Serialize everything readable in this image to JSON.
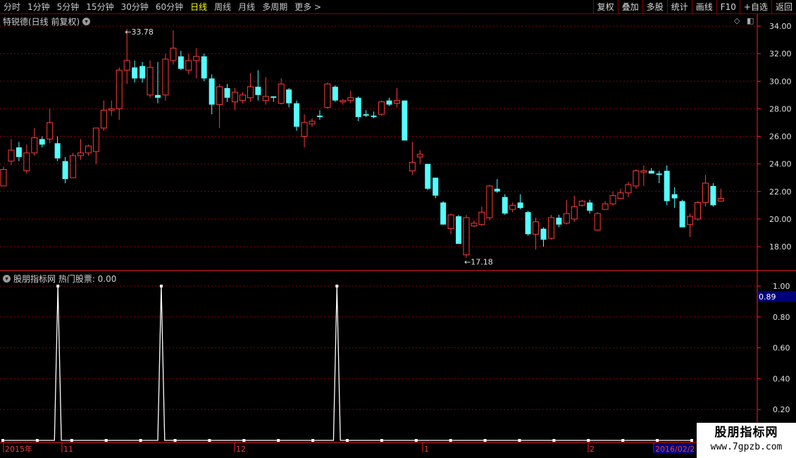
{
  "toolbar": {
    "tabs": [
      {
        "label": "分时",
        "active": false
      },
      {
        "label": "1分钟",
        "active": false
      },
      {
        "label": "5分钟",
        "active": false
      },
      {
        "label": "15分钟",
        "active": false
      },
      {
        "label": "30分钟",
        "active": false
      },
      {
        "label": "60分钟",
        "active": false
      },
      {
        "label": "日线",
        "active": true
      },
      {
        "label": "周线",
        "active": false
      },
      {
        "label": "月线",
        "active": false
      },
      {
        "label": "多周期",
        "active": false
      },
      {
        "label": "更多 >",
        "active": false
      }
    ],
    "buttons": [
      "复权",
      "叠加",
      "多股",
      "统计",
      "画线",
      "F10",
      "+自选",
      "返回"
    ]
  },
  "main_chart": {
    "title": "特锐德(日线 前复权)",
    "corner_icons": [
      "◇",
      "◧"
    ],
    "high_label": "33.78",
    "low_label": "17.18"
  },
  "indicator": {
    "title": "股朋指标网 热门股票: 0.00",
    "cursor_value": "0.89"
  },
  "date_axis": [
    "2015年",
    "11",
    "12",
    "1",
    "2",
    "2016/02/2"
  ],
  "watermark": {
    "line1": "股朋指标网",
    "line2": "www.7gpzb.com"
  },
  "colors": {
    "up": "#ff3b3b",
    "down": "#54ffff",
    "grid": "#8b0000",
    "axis": "#ff2020",
    "indicator": "#ffffff"
  },
  "chart_data": [
    {
      "type": "candlestick",
      "title": "特锐德(日线 前复权)",
      "ylim": [
        17,
        35
      ],
      "yticks": [
        18,
        20,
        22,
        24,
        26,
        28,
        30,
        32,
        34
      ],
      "candles": [
        {
          "o": 22.4,
          "h": 23.8,
          "l": 22.4,
          "c": 23.6
        },
        {
          "o": 24.2,
          "h": 25.8,
          "l": 23.9,
          "c": 25.0
        },
        {
          "o": 25.2,
          "h": 25.6,
          "l": 24.2,
          "c": 24.5
        },
        {
          "o": 23.5,
          "h": 25.4,
          "l": 23.3,
          "c": 24.8
        },
        {
          "o": 24.8,
          "h": 26.6,
          "l": 24.6,
          "c": 25.9
        },
        {
          "o": 25.8,
          "h": 26.0,
          "l": 25.2,
          "c": 25.4
        },
        {
          "o": 25.8,
          "h": 28.0,
          "l": 25.5,
          "c": 27.0
        },
        {
          "o": 25.5,
          "h": 26.0,
          "l": 24.2,
          "c": 24.4
        },
        {
          "o": 24.2,
          "h": 24.5,
          "l": 22.6,
          "c": 22.9
        },
        {
          "o": 23.0,
          "h": 24.8,
          "l": 23.0,
          "c": 24.6
        },
        {
          "o": 24.6,
          "h": 25.8,
          "l": 24.3,
          "c": 24.8
        },
        {
          "o": 24.8,
          "h": 25.4,
          "l": 24.6,
          "c": 25.3
        },
        {
          "o": 24.9,
          "h": 26.6,
          "l": 24.0,
          "c": 26.6
        },
        {
          "o": 26.6,
          "h": 28.6,
          "l": 26.4,
          "c": 27.9
        },
        {
          "o": 27.9,
          "h": 28.6,
          "l": 27.5,
          "c": 28.0
        },
        {
          "o": 28.0,
          "h": 31.0,
          "l": 27.2,
          "c": 30.8
        },
        {
          "o": 30.8,
          "h": 33.8,
          "l": 29.8,
          "c": 31.5
        },
        {
          "o": 31.0,
          "h": 31.5,
          "l": 29.9,
          "c": 30.2
        },
        {
          "o": 31.1,
          "h": 31.4,
          "l": 29.9,
          "c": 30.2
        },
        {
          "o": 29.0,
          "h": 31.5,
          "l": 28.8,
          "c": 31.0
        },
        {
          "o": 29.0,
          "h": 31.4,
          "l": 28.4,
          "c": 28.8
        },
        {
          "o": 29.0,
          "h": 32.0,
          "l": 28.6,
          "c": 31.6
        },
        {
          "o": 31.5,
          "h": 33.7,
          "l": 31.2,
          "c": 32.4
        },
        {
          "o": 31.8,
          "h": 32.2,
          "l": 30.8,
          "c": 30.9
        },
        {
          "o": 30.8,
          "h": 32.0,
          "l": 30.5,
          "c": 31.5
        },
        {
          "o": 31.5,
          "h": 32.4,
          "l": 30.2,
          "c": 31.8
        },
        {
          "o": 31.8,
          "h": 32.0,
          "l": 30.0,
          "c": 30.2
        },
        {
          "o": 30.2,
          "h": 30.5,
          "l": 27.6,
          "c": 28.3
        },
        {
          "o": 28.3,
          "h": 29.8,
          "l": 26.6,
          "c": 29.6
        },
        {
          "o": 29.5,
          "h": 29.8,
          "l": 28.5,
          "c": 28.8
        },
        {
          "o": 28.5,
          "h": 29.5,
          "l": 27.9,
          "c": 29.2
        },
        {
          "o": 28.6,
          "h": 29.2,
          "l": 28.4,
          "c": 29.0
        },
        {
          "o": 28.8,
          "h": 30.6,
          "l": 28.5,
          "c": 29.6
        },
        {
          "o": 29.6,
          "h": 30.8,
          "l": 28.6,
          "c": 29.0
        },
        {
          "o": 28.6,
          "h": 30.3,
          "l": 28.3,
          "c": 28.9
        },
        {
          "o": 28.9,
          "h": 28.9,
          "l": 28.5,
          "c": 28.8
        },
        {
          "o": 28.4,
          "h": 30.2,
          "l": 28.3,
          "c": 29.8
        },
        {
          "o": 29.4,
          "h": 29.5,
          "l": 28.1,
          "c": 28.4
        },
        {
          "o": 28.4,
          "h": 28.6,
          "l": 26.4,
          "c": 26.7
        },
        {
          "o": 26.0,
          "h": 27.6,
          "l": 25.2,
          "c": 27.0
        },
        {
          "o": 26.9,
          "h": 27.3,
          "l": 26.7,
          "c": 27.1
        },
        {
          "o": 27.5,
          "h": 27.9,
          "l": 27.2,
          "c": 27.4
        },
        {
          "o": 28.1,
          "h": 29.9,
          "l": 28.0,
          "c": 29.8
        },
        {
          "o": 29.6,
          "h": 29.7,
          "l": 28.5,
          "c": 28.6
        },
        {
          "o": 28.5,
          "h": 28.7,
          "l": 28.3,
          "c": 28.6
        },
        {
          "o": 28.6,
          "h": 29.3,
          "l": 28.4,
          "c": 28.8
        },
        {
          "o": 28.8,
          "h": 28.9,
          "l": 27.1,
          "c": 27.4
        },
        {
          "o": 27.6,
          "h": 27.9,
          "l": 27.4,
          "c": 27.5
        },
        {
          "o": 27.5,
          "h": 27.8,
          "l": 27.3,
          "c": 27.4
        },
        {
          "o": 27.6,
          "h": 28.6,
          "l": 27.5,
          "c": 28.5
        },
        {
          "o": 28.6,
          "h": 28.8,
          "l": 28.2,
          "c": 28.3
        },
        {
          "o": 28.4,
          "h": 29.5,
          "l": 28.1,
          "c": 28.6
        },
        {
          "o": 28.6,
          "h": 28.6,
          "l": 25.7,
          "c": 25.7
        },
        {
          "o": 23.5,
          "h": 25.6,
          "l": 23.2,
          "c": 24.1
        },
        {
          "o": 24.5,
          "h": 25.0,
          "l": 24.0,
          "c": 24.7
        },
        {
          "o": 24.0,
          "h": 24.0,
          "l": 22.1,
          "c": 22.2
        },
        {
          "o": 23.0,
          "h": 23.0,
          "l": 21.5,
          "c": 21.7
        },
        {
          "o": 21.2,
          "h": 21.3,
          "l": 19.6,
          "c": 19.6
        },
        {
          "o": 19.3,
          "h": 20.4,
          "l": 18.9,
          "c": 20.3
        },
        {
          "o": 20.2,
          "h": 20.3,
          "l": 18.2,
          "c": 18.2
        },
        {
          "o": 17.4,
          "h": 20.3,
          "l": 17.2,
          "c": 20.1
        },
        {
          "o": 19.5,
          "h": 19.9,
          "l": 19.4,
          "c": 19.7
        },
        {
          "o": 19.6,
          "h": 20.9,
          "l": 19.5,
          "c": 20.5
        },
        {
          "o": 20.1,
          "h": 22.5,
          "l": 19.9,
          "c": 22.4
        },
        {
          "o": 22.2,
          "h": 22.9,
          "l": 21.9,
          "c": 22.0
        },
        {
          "o": 21.6,
          "h": 21.8,
          "l": 20.3,
          "c": 20.4
        },
        {
          "o": 20.7,
          "h": 21.2,
          "l": 20.5,
          "c": 21.0
        },
        {
          "o": 21.2,
          "h": 21.8,
          "l": 20.7,
          "c": 20.8
        },
        {
          "o": 20.5,
          "h": 20.6,
          "l": 18.8,
          "c": 18.9
        },
        {
          "o": 18.9,
          "h": 20.1,
          "l": 17.8,
          "c": 19.8
        },
        {
          "o": 19.3,
          "h": 19.4,
          "l": 18.0,
          "c": 18.5
        },
        {
          "o": 18.6,
          "h": 20.3,
          "l": 18.5,
          "c": 20.1
        },
        {
          "o": 20.1,
          "h": 20.3,
          "l": 19.4,
          "c": 19.6
        },
        {
          "o": 19.7,
          "h": 21.4,
          "l": 19.6,
          "c": 20.4
        },
        {
          "o": 20.0,
          "h": 21.7,
          "l": 19.8,
          "c": 20.9
        },
        {
          "o": 21.0,
          "h": 21.4,
          "l": 20.9,
          "c": 21.3
        },
        {
          "o": 21.2,
          "h": 21.4,
          "l": 20.4,
          "c": 20.6
        },
        {
          "o": 19.2,
          "h": 20.5,
          "l": 19.2,
          "c": 20.4
        },
        {
          "o": 20.7,
          "h": 21.3,
          "l": 20.7,
          "c": 21.1
        },
        {
          "o": 21.1,
          "h": 22.0,
          "l": 21.0,
          "c": 21.7
        },
        {
          "o": 21.5,
          "h": 22.2,
          "l": 21.5,
          "c": 21.9
        },
        {
          "o": 21.9,
          "h": 22.7,
          "l": 21.6,
          "c": 22.5
        },
        {
          "o": 22.4,
          "h": 23.6,
          "l": 22.2,
          "c": 23.5
        },
        {
          "o": 23.4,
          "h": 23.9,
          "l": 22.4,
          "c": 23.5
        },
        {
          "o": 23.5,
          "h": 23.7,
          "l": 23.3,
          "c": 23.3
        },
        {
          "o": 23.3,
          "h": 23.5,
          "l": 22.6,
          "c": 23.2
        },
        {
          "o": 23.5,
          "h": 23.9,
          "l": 21.0,
          "c": 21.3
        },
        {
          "o": 21.8,
          "h": 22.3,
          "l": 20.8,
          "c": 21.5
        },
        {
          "o": 21.3,
          "h": 21.4,
          "l": 19.4,
          "c": 19.4
        },
        {
          "o": 19.6,
          "h": 20.4,
          "l": 18.7,
          "c": 20.2
        },
        {
          "o": 20.0,
          "h": 21.3,
          "l": 19.9,
          "c": 21.2
        },
        {
          "o": 21.2,
          "h": 23.2,
          "l": 20.9,
          "c": 22.6
        },
        {
          "o": 22.4,
          "h": 22.6,
          "l": 20.9,
          "c": 21.0
        },
        {
          "o": 21.3,
          "h": 22.2,
          "l": 21.3,
          "c": 21.5
        }
      ]
    },
    {
      "type": "line",
      "title": "股朋指标网 热门股票",
      "ylim": [
        0,
        1.05
      ],
      "yticks": [
        0.2,
        0.4,
        0.6,
        0.8,
        1.0
      ],
      "values": [
        0,
        0,
        0,
        0,
        0,
        0,
        0,
        0,
        0,
        0,
        0,
        0,
        0,
        0,
        0,
        0,
        1,
        0,
        0,
        0,
        0,
        0,
        0,
        0,
        0,
        0,
        0,
        0,
        0,
        0,
        0,
        0,
        0,
        0,
        0,
        0,
        0,
        0,
        0,
        0,
        0,
        0,
        0,
        0,
        0,
        0,
        1,
        0,
        0,
        0,
        0,
        0,
        0,
        0,
        0,
        0,
        0,
        0,
        0,
        0,
        0,
        0,
        0,
        0,
        0,
        0,
        0,
        0,
        0,
        0,
        0,
        0,
        0,
        0,
        0,
        0,
        0,
        0,
        0,
        0,
        0,
        0,
        0,
        0,
        0,
        0,
        0,
        0,
        0,
        0,
        0,
        0,
        0,
        0,
        0,
        0,
        0,
        1,
        0,
        0,
        0,
        0,
        0,
        0,
        0,
        0,
        0,
        0,
        0,
        0,
        0,
        0,
        0,
        0,
        0,
        0,
        0,
        0,
        0,
        0,
        0,
        0,
        0,
        0,
        0,
        0,
        0,
        0,
        0,
        0,
        0,
        0,
        0,
        0,
        0,
        0,
        0,
        0,
        0,
        0,
        0,
        0,
        0,
        0,
        0,
        0,
        0,
        0,
        0,
        0,
        0,
        0,
        0,
        0,
        0,
        0,
        0,
        0,
        0,
        0,
        0,
        0,
        0,
        0,
        0,
        0,
        0,
        0,
        0,
        0,
        0,
        0,
        0,
        0,
        0,
        0,
        0,
        0,
        0,
        0,
        0,
        0,
        0,
        0,
        0,
        0,
        0,
        0,
        0,
        0,
        0,
        0,
        0,
        0,
        0,
        0,
        0,
        0,
        0,
        0,
        0
      ]
    }
  ]
}
